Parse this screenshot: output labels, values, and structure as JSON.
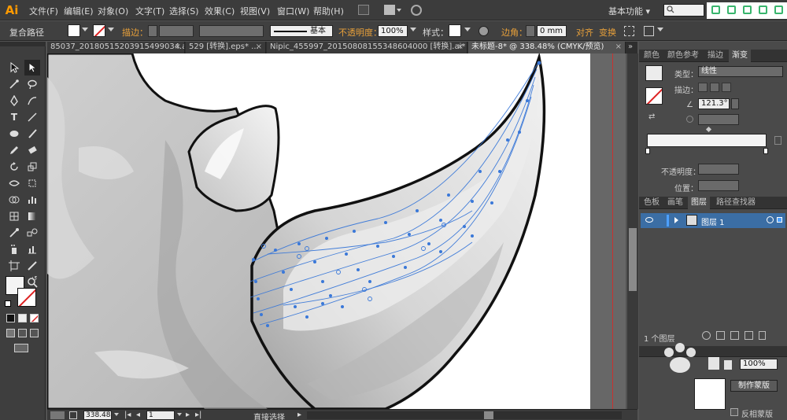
{
  "app": {
    "logo_text": "Ai"
  },
  "menu": {
    "items": [
      "文件(F)",
      "编辑(E)",
      "对象(O)",
      "文字(T)",
      "选择(S)",
      "效果(C)",
      "视图(V)",
      "窗口(W)",
      "帮助(H)"
    ],
    "workspace": "基本功能",
    "workspace_arrow": "▾"
  },
  "control": {
    "selection_label": "复合路径",
    "stroke_label": "描边：",
    "stroke_style": "基本",
    "opacity_label": "不透明度：",
    "opacity_value": "100%",
    "style_label": "样式：",
    "corner_label": "边角：",
    "corner_value": "0 mm",
    "align_label": "对齐",
    "transform_label": "变换"
  },
  "tabs": [
    {
      "label": "85037_20180515203915499034.ai*",
      "active": false
    },
    {
      "label": "529 [转换].eps* ...",
      "active": false
    },
    {
      "label": "Nipic_455997_20150808155348604000 [转换].ai*",
      "active": false
    },
    {
      "label": "未标题-8* @ 338.48% (CMYK/预览)",
      "active": true
    }
  ],
  "status": {
    "zoom": "338.48",
    "artboard": "1",
    "tool_name": "直接选择"
  },
  "gradient_panel": {
    "tabs": [
      "颜色",
      "颜色参考",
      "描边",
      "渐变"
    ],
    "active_tab": "渐变",
    "type_label": "类型：",
    "type_value": "线性",
    "stroke_label": "描边：",
    "angle_value": "121.3°",
    "opacity_label": "不透明度：",
    "location_label": "位置："
  },
  "layers_panel": {
    "tabs": [
      "色板",
      "画笔",
      "图层",
      "路径查找器"
    ],
    "active_tab": "图层",
    "layer_name": "图层 1",
    "layer_count": "1 个图层"
  },
  "transparency_panel": {
    "opacity_value": "100%",
    "make_mask_label": "制作蒙版",
    "invert_mask_label": "反相蒙版"
  },
  "colors": {
    "accent": "#e8a03a",
    "selection_blue": "#3b6ea5",
    "path_blue": "#3a78d8",
    "artboard_red": "#c8322f"
  }
}
